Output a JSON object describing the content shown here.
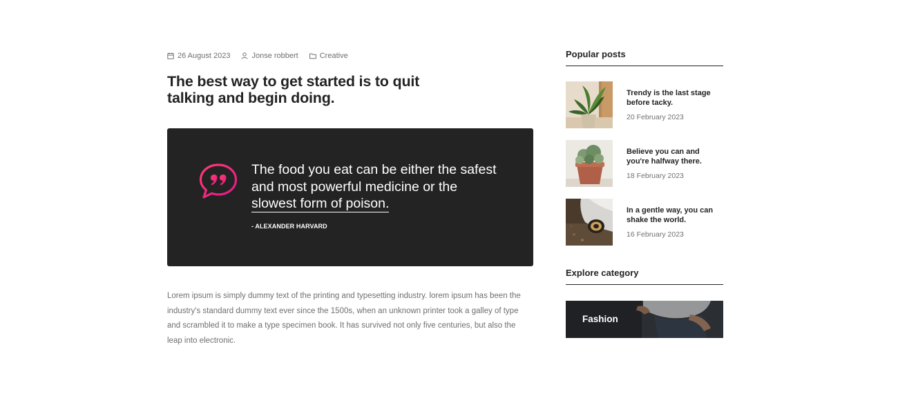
{
  "post": {
    "meta": {
      "date": "26 August 2023",
      "author": "Jonse robbert",
      "category": "Creative"
    },
    "title": "The best way to get started is to quit talking and begin doing.",
    "quote": {
      "text_before": "The food you eat can be either the safest and most powerful medicine or the ",
      "link_text": "slowest form of poison.",
      "author": "- ALEXANDER HARVARD"
    },
    "body": "Lorem ipsum is simply dummy text of the printing and typesetting industry. lorem ipsum has been the industry's standard dummy text ever since the 1500s, when an unknown printer took a galley of type and scrambled it to make a type specimen book. It has survived not only five centuries, but also the leap into electronic."
  },
  "sidebar": {
    "popular_heading": "Popular posts",
    "popular_posts": [
      {
        "title": "Trendy is the last stage before tacky.",
        "date": "20 February 2023",
        "thumb": "plant-icon"
      },
      {
        "title": "Believe you can and you're halfway there.",
        "date": "18 February 2023",
        "thumb": "potted-plant-icon"
      },
      {
        "title": "In a gentle way, you can shake the world.",
        "date": "16 February 2023",
        "thumb": "speaker-icon"
      }
    ],
    "explore_heading": "Explore category",
    "category": {
      "label": "Fashion"
    }
  },
  "colors": {
    "text": "#232323",
    "muted": "#6f6f6f",
    "quote_bg": "#232323",
    "quote_icon_gradient": [
      "#ff3d6e",
      "#e0168a"
    ]
  }
}
